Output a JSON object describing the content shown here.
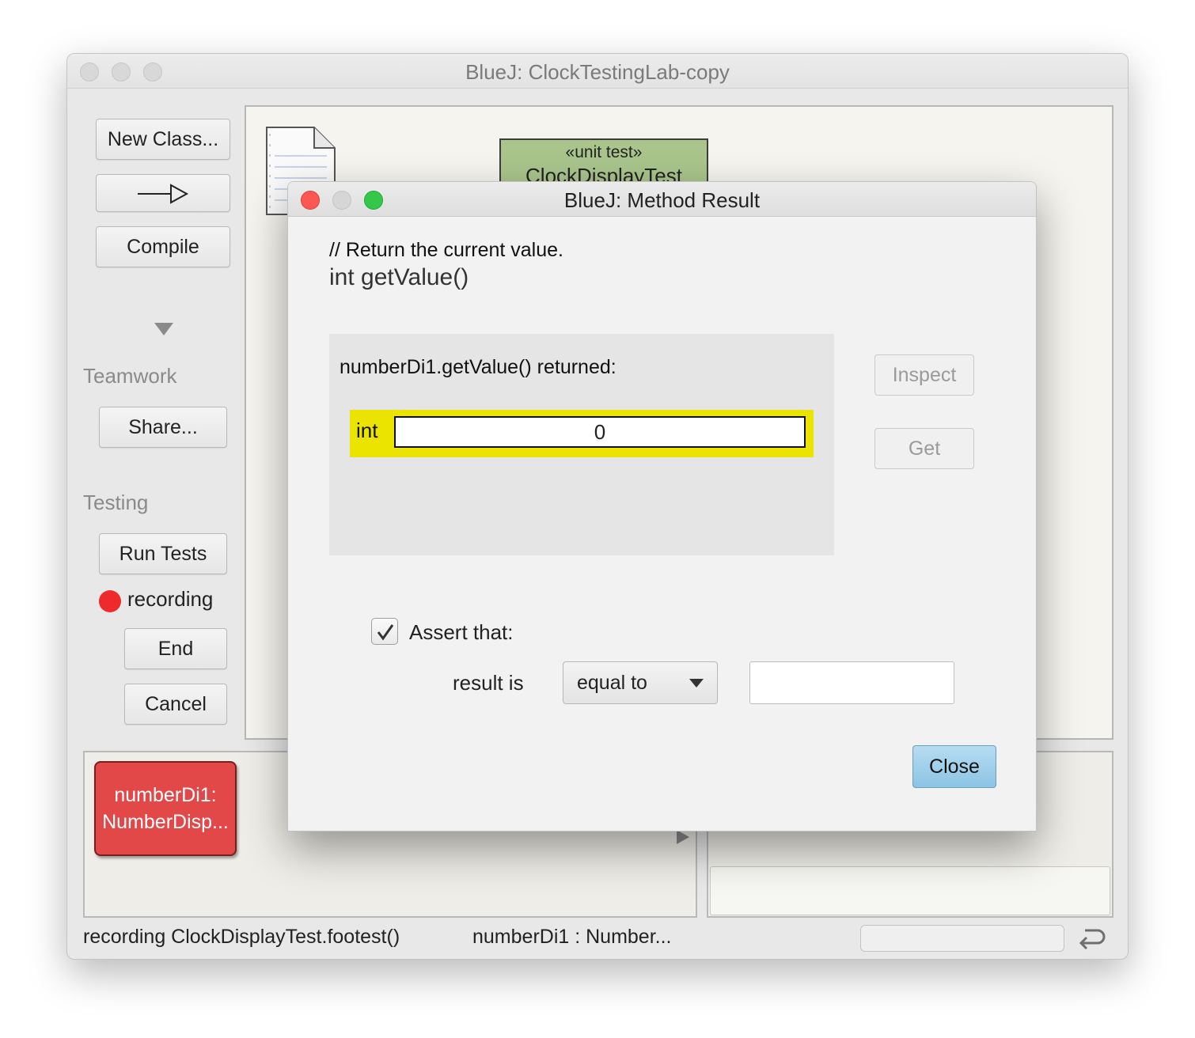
{
  "main_window": {
    "title": "BlueJ:  ClockTestingLab-copy",
    "toolbar": {
      "new_class": "New Class...",
      "compile": "Compile"
    },
    "teamwork": {
      "label": "Teamwork",
      "share": "Share..."
    },
    "testing": {
      "label": "Testing",
      "run_tests": "Run Tests",
      "recording": "recording",
      "end": "End",
      "cancel": "Cancel"
    },
    "class_diagram": {
      "unit_test_stereotype": "«unit test»",
      "unit_test_name": "ClockDisplayTest"
    },
    "object_bench": {
      "objects": [
        {
          "line1": "numberDi1:",
          "line2": "NumberDisp..."
        }
      ]
    },
    "status_bar": {
      "recording_text": "recording ClockDisplayTest.footest()",
      "selected_object": "numberDi1 : Number..."
    }
  },
  "dialog": {
    "title": "BlueJ:  Method Result",
    "comment": "// Return the current value.",
    "signature": "int getValue()",
    "returned_label": "numberDi1.getValue() returned:",
    "result_type": "int",
    "result_value": "0",
    "inspect": "Inspect",
    "get": "Get",
    "assert_label": "Assert that:",
    "assert_checked": true,
    "result_is_label": "result is",
    "comparison": "equal to",
    "expected_value": "",
    "close": "Close"
  },
  "colors": {
    "unit_test_class": "#a9c58c",
    "object_bench_item": "#e24848",
    "result_highlight": "#eae400",
    "recording_dot": "#ee2a2a",
    "close_button": "#9ccde9"
  }
}
